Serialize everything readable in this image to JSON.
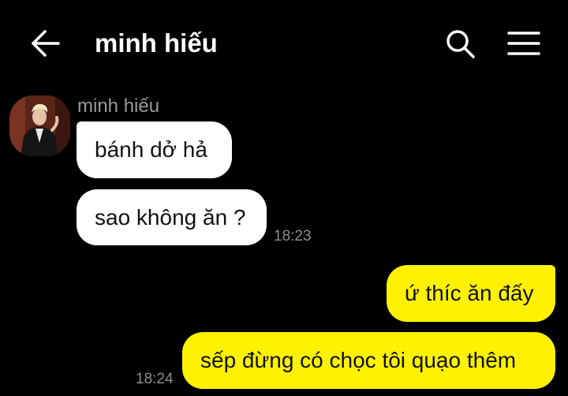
{
  "header": {
    "title": "minh hiếu",
    "back_icon": "arrow-left-icon",
    "search_icon": "search-icon",
    "menu_icon": "hamburger-menu-icon"
  },
  "conversation": {
    "sender_name": "minh hiếu",
    "messages": [
      {
        "direction": "incoming",
        "text": "bánh dở hả"
      },
      {
        "direction": "incoming",
        "text": "sao không ăn ?",
        "time": "18:23"
      },
      {
        "direction": "outgoing",
        "text": "ứ thíc ăn đấy"
      },
      {
        "direction": "outgoing",
        "text": "sếp đừng có chọc tôi quạo thêm",
        "time": "18:24"
      }
    ]
  },
  "colors": {
    "background": "#000000",
    "incoming_bubble": "#ffffff",
    "outgoing_bubble": "#fff200",
    "timestamp": "#8e8e8e",
    "sender_name": "#9a9a9a"
  }
}
